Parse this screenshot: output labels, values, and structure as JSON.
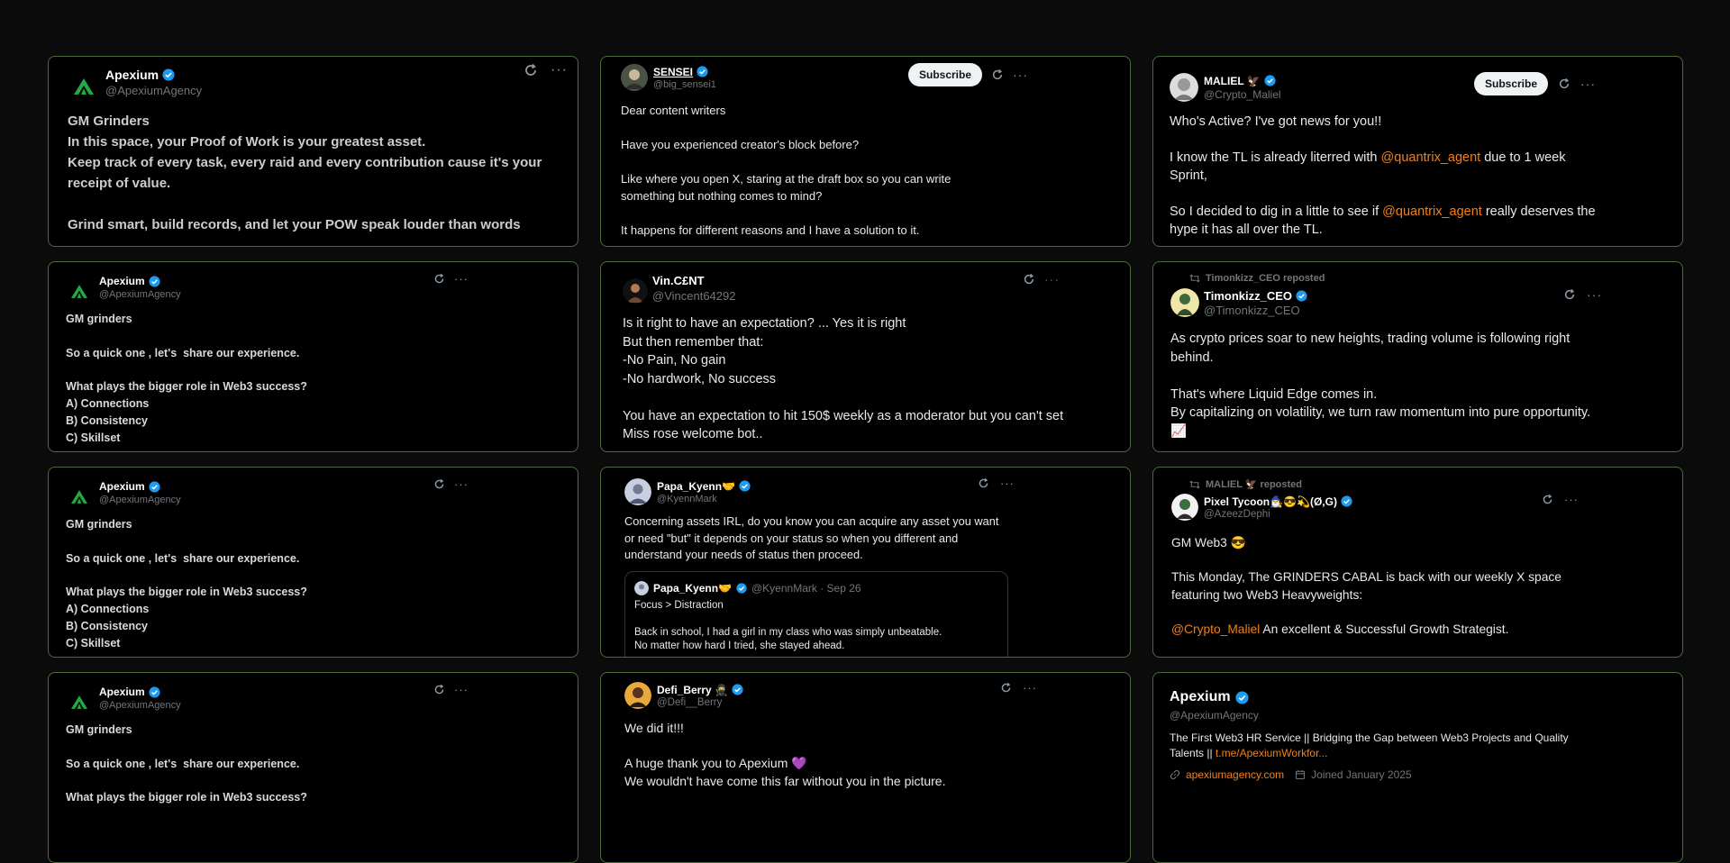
{
  "cards": {
    "c1": {
      "name": "Apexium",
      "handle": "@ApexiumAgency",
      "text": "GM Grinders\nIn this space, your Proof of Work is your greatest asset.\nKeep track of every task, every raid and every contribution cause it's your receipt of value.\n\nGrind smart, build records, and let your POW speak louder than words"
    },
    "c2": {
      "name": "SENSEI",
      "handle": "@big_sensei1",
      "subscribe": "Subscribe",
      "text": "Dear content writers\n\nHave you experienced creator's block before?\n\nLike where you open X, staring at the draft box so you can write something but nothing comes to mind?\n\nIt happens for different reasons and I have a solution to it."
    },
    "c3": {
      "name": "MALIEL 🦅",
      "handle": "@Crypto_Maliel",
      "subscribe": "Subscribe",
      "line1": "Who's Active? I've got news for you!!",
      "line2a": "I know the TL is already literred with ",
      "mention1": "@quantrix_agent",
      "line2b": " due to 1 week Sprint,",
      "line3a": "So I decided to dig in a little to see if ",
      "mention2": "@quantrix_agent",
      "line3b": " really deserves the hype it has all over the TL."
    },
    "c4": {
      "name": "Apexium",
      "handle": "@ApexiumAgency",
      "text": "GM grinders\n\nSo a quick one , let's  share our experience.\n\nWhat plays the bigger role in Web3 success?\nA) Connections\nB) Consistency\nC) Skillset"
    },
    "c5": {
      "name": "Vin.C£NT",
      "handle": "@Vincent64292",
      "text": "Is it right to have an expectation? ... Yes it is right\nBut then remember that:\n-No Pain, No gain\n-No hardwork, No success\n\nYou have an expectation to hit 150$ weekly as a moderator but you can't set Miss rose welcome bot.."
    },
    "c6": {
      "reposted": "Timonkizz_CEO reposted",
      "name": "Timonkizz_CEO",
      "handle": "@Timonkizz_CEO",
      "text": "As crypto prices soar to new heights, trading volume is following right behind.\n\nThat's where Liquid Edge comes in.\nBy capitalizing on volatility, we turn raw momentum into pure opportunity. 📈"
    },
    "c7": {
      "name": "Apexium",
      "handle": "@ApexiumAgency",
      "text": "GM grinders\n\nSo a quick one , let's  share our experience.\n\nWhat plays the bigger role in Web3 success?\nA) Connections\nB) Consistency\nC) Skillset"
    },
    "c8": {
      "name": "Papa_Kyenn🤝",
      "handle": "@KyennMark",
      "text": "Concerning assets IRL, do you know you can acquire any asset you want or need \"but\" it depends on your status so when you different and understand your needs of status then proceed.",
      "quote": {
        "name": "Papa_Kyenn🤝",
        "meta": "@KyennMark · Sep 26",
        "text": "Focus > Distraction\n\nBack in school, I had a girl in my class who was simply unbeatable.\nNo matter how hard I tried, she stayed ahead."
      }
    },
    "c9": {
      "reposted": "MALIEL 🦅 reposted",
      "name": "Pixel Tycoon🧙‍♂️😎💫(Ø,G)",
      "handle": "@AzeezDephi",
      "line1": "GM Web3 😎",
      "line2": "This Monday, The GRINDERS CABAL is back with our weekly X space featuring two Web3 Heavyweights:",
      "mention": "@Crypto_Maliel",
      "line3": " An excellent & Successful Growth Strategist."
    },
    "c10": {
      "name": "Apexium",
      "handle": "@ApexiumAgency",
      "text": "GM grinders\n\nSo a quick one , let's  share our experience.\n\nWhat plays the bigger role in Web3 success?"
    },
    "c11": {
      "name": "Defi_Berry 🥷",
      "handle": "@Defi__Berry",
      "text": "We did it!!!\n\nA huge thank you to Apexium 💜\nWe wouldn't have come this far without you in the picture."
    },
    "c12": {
      "name": "Apexium",
      "handle": "@ApexiumAgency",
      "bio": "The First Web3 HR Service || Bridging the Gap between Web3 Projects and Quality Talents || ",
      "bio_link": "t.me/ApexiumWorkfor...",
      "site": "apexiumagency.com",
      "joined": "Joined January 2025"
    }
  },
  "icons": {
    "verified": "verified-badge-icon",
    "refresh": "refresh-icon",
    "more": "more-icon",
    "link": "link-icon",
    "calendar": "calendar-icon",
    "repost": "repost-icon"
  },
  "colors": {
    "accent": "#f0801a",
    "verified": "#1d9bf0",
    "border": "#4d6b3a"
  }
}
